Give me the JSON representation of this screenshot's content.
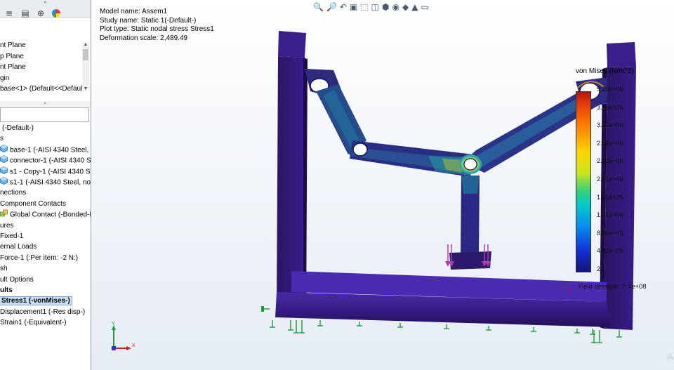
{
  "left_panel": {
    "top_grip": "«",
    "mid_grip": "«",
    "feature_tree": [
      {
        "label": "nt Plane"
      },
      {
        "label": "p Plane"
      },
      {
        "label": "nt Plane"
      },
      {
        "label": "gin"
      },
      {
        "label": "base<1> (Default<<Default"
      }
    ],
    "study_tree": [
      {
        "label": "(-Default-)",
        "indent": 3,
        "bold": false,
        "icon": ""
      },
      {
        "label": "s",
        "indent": 0,
        "bold": false,
        "icon": ""
      },
      {
        "label": "base-1 (-AISI 4340 Steel, n",
        "indent": 0,
        "bold": false,
        "icon": "part-icon"
      },
      {
        "label": "connector-1 (-AISI 4340 St",
        "indent": 0,
        "bold": false,
        "icon": "part-icon"
      },
      {
        "label": "s1 - Copy-1 (-AISI 4340 Ste",
        "indent": 0,
        "bold": false,
        "icon": "part-icon"
      },
      {
        "label": "s1-1 (-AISI 4340 Steel, norr",
        "indent": 0,
        "bold": false,
        "icon": "part-icon"
      },
      {
        "label": "nections",
        "indent": 0,
        "bold": false,
        "icon": ""
      },
      {
        "label": "Component Contacts",
        "indent": 0,
        "bold": false,
        "icon": ""
      },
      {
        "label": "Global Contact (-Bonded-I",
        "indent": 0,
        "bold": false,
        "icon": "contact-icon"
      },
      {
        "label": "ures",
        "indent": 0,
        "bold": false,
        "icon": ""
      },
      {
        "label": "Fixed-1",
        "indent": 0,
        "bold": false,
        "icon": ""
      },
      {
        "label": "ernal Loads",
        "indent": 0,
        "bold": false,
        "icon": ""
      },
      {
        "label": "Force-1 (:Per item: -2 N:)",
        "indent": 0,
        "bold": false,
        "icon": ""
      },
      {
        "label": "sh",
        "indent": 0,
        "bold": false,
        "icon": ""
      },
      {
        "label": "ult Options",
        "indent": 0,
        "bold": false,
        "icon": ""
      },
      {
        "label": "ults",
        "indent": 0,
        "bold": true,
        "icon": ""
      },
      {
        "label": "Stress1 (-vonMises-)",
        "indent": 0,
        "bold": true,
        "icon": "",
        "selected": true
      },
      {
        "label": "Displacement1 (-Res disp-)",
        "indent": 0,
        "bold": false,
        "icon": ""
      },
      {
        "label": "Strain1 (-Equivalent-)",
        "indent": 0,
        "bold": false,
        "icon": ""
      }
    ]
  },
  "viewport": {
    "info": {
      "model_name": "Model name: Assem1",
      "study_name": "Study name: Static 1(-Default-)",
      "plot_type": "Plot type: Static nodal stress Stress1",
      "deformation": "Deformation scale: 2,489.49"
    },
    "toolbar_icons": [
      "zoom-fit-icon",
      "zoom-area-icon",
      "previous-view-icon",
      "section-view-icon",
      "dynamic-annotation-icon",
      "view-orientation-icon",
      "display-style-icon",
      "hide-show-icon",
      "edit-appearance-icon",
      "apply-scene-icon",
      "view-settings-icon"
    ],
    "legend": {
      "title": "von Mises (N/m^2)",
      "ticks": [
        "5.20e+06",
        "3.65e+06",
        "3.22e+06",
        "2.82e+06",
        "2.42e+06",
        "2.01e+06",
        "1.61e+06",
        "1.21e+06",
        "8.05e+05",
        "4.02e+05",
        "23"
      ],
      "yield": "Yield strength: 7.1e+08"
    },
    "watermark": "A"
  }
}
